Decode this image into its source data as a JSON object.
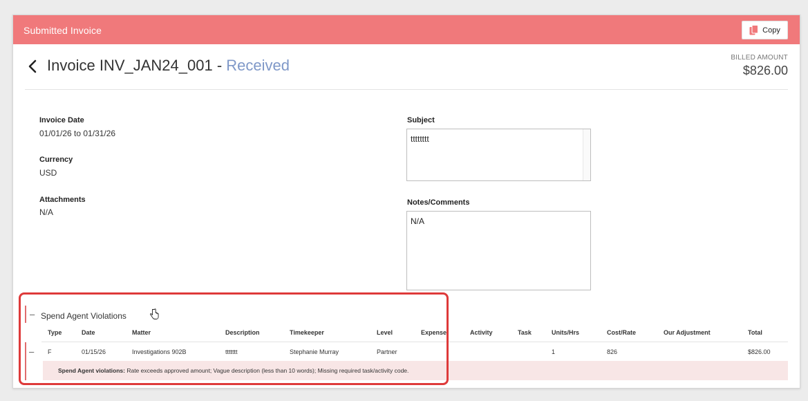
{
  "header": {
    "title": "Submitted Invoice",
    "copy_label": "Copy"
  },
  "invoice": {
    "title": "Invoice INV_JAN24_001",
    "separator": " - ",
    "status": "Received",
    "billed_label": "BILLED AMOUNT",
    "billed_amount": "$826.00"
  },
  "details": {
    "invoice_date_label": "Invoice Date",
    "invoice_date_value": "01/01/26 to 01/31/26",
    "currency_label": "Currency",
    "currency_value": "USD",
    "attachments_label": "Attachments",
    "attachments_value": "N/A",
    "subject_label": "Subject",
    "subject_value": "tttttttt",
    "notes_label": "Notes/Comments",
    "notes_value": "N/A"
  },
  "violations": {
    "section_title": "Spend Agent Violations",
    "collapse_symbol": "–",
    "columns": [
      "Type",
      "Date",
      "Matter",
      "Description",
      "Timekeeper",
      "Level",
      "Expense",
      "Activity",
      "Task",
      "Units/Hrs",
      "Cost/Rate",
      "Our Adjustment",
      "Total"
    ],
    "row": {
      "collapse_symbol": "–",
      "type": "F",
      "date": "01/15/26",
      "matter": "Investigations 902B",
      "description": "ttttttt",
      "timekeeper": "Stephanie Murray",
      "level": "Partner",
      "expense": "",
      "activity": "",
      "task": "",
      "units": "1",
      "cost_rate": "826",
      "adjustment": "",
      "total": "$826.00"
    },
    "detail_label": "Spend Agent violations:",
    "detail_text": " Rate exceeds approved amount; Vague description (less than 10 words); Missing required task/activity code."
  },
  "colors": {
    "header_bg": "#f0797b",
    "status_text": "#7f98c8",
    "violation_bg": "#f8e6e6",
    "highlight_border": "#de3a3a"
  },
  "icons": [
    "copy-icon",
    "chevron-left-icon",
    "hand-cursor-icon"
  ]
}
